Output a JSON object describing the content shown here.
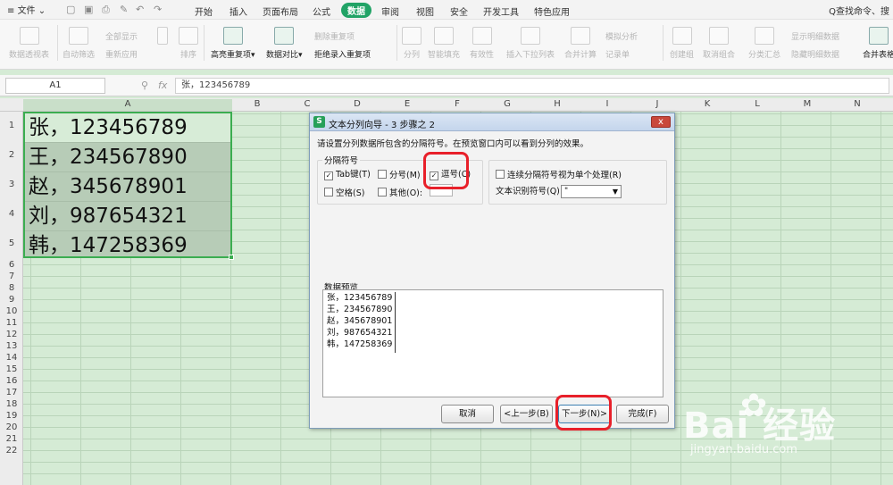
{
  "menubar": {
    "file": "文件",
    "tabs": [
      "开始",
      "插入",
      "页面布局",
      "公式",
      "数据",
      "审阅",
      "视图",
      "安全",
      "开发工具",
      "特色应用"
    ],
    "active_tab": "数据",
    "search": "Q查找命令、搜"
  },
  "ribbon": {
    "pivot": "数据透视表",
    "autofilter": "自动筛选",
    "show_all": "全部显示",
    "reapply": "重新应用",
    "sort": "排序",
    "highlight_dup": "高亮重复项",
    "data_compare": "数据对比",
    "delete_dup": "删除重复项",
    "reject_dup": "拒绝录入重复项",
    "split": "分列",
    "smart_fill": "智能填充",
    "validity": "有效性",
    "insert_dropdown": "插入下拉列表",
    "merge_calc": "合并计算",
    "simulate": "模拟分析",
    "record": "记录单",
    "create_group": "创建组",
    "ungroup": "取消组合",
    "subtotal": "分类汇总",
    "show_detail": "显示明细数据",
    "hide_detail": "隐藏明细数据",
    "merge_table": "合并表格"
  },
  "formulabar": {
    "cell_ref": "A1",
    "fx": "fx",
    "content": "张，123456789"
  },
  "columns": [
    "A",
    "B",
    "C",
    "D",
    "E",
    "F",
    "G",
    "H",
    "I",
    "J",
    "K",
    "L",
    "M",
    "N"
  ],
  "rows": [
    "1",
    "2",
    "3",
    "4",
    "5",
    "6",
    "7",
    "8",
    "9",
    "10",
    "11",
    "12",
    "13",
    "14",
    "15",
    "16",
    "17",
    "18",
    "19",
    "20",
    "21",
    "22"
  ],
  "cells": [
    "张，123456789",
    "王，234567890",
    "赵，345678901",
    "刘，987654321",
    "韩，147258369"
  ],
  "dialog": {
    "title": "文本分列向导 - 3 步骤之 2",
    "logo": "S",
    "close": "x",
    "instruction": "请设置分列数据所包含的分隔符号。在预览窗口内可以看到分列的效果。",
    "delimiter_group": "分隔符号",
    "tab": "Tab键(T)",
    "semicolon": "分号(M)",
    "comma": "逗号(C)",
    "space": "空格(S)",
    "other": "其他(O):",
    "consecutive": "连续分隔符号视为单个处理(R)",
    "qualifier_label": "文本识别符号(Q):",
    "qualifier_value": "\"",
    "preview_label": "数据预览",
    "preview_lines": [
      "张，123456789",
      "王，234567890",
      "赵，345678901",
      "刘，987654321",
      "韩，147258369"
    ],
    "cancel": "取消",
    "back": "<上一步(B)",
    "next": "下一步(N)>",
    "finish": "完成(F)"
  },
  "checks": {
    "tab": true,
    "semicolon": false,
    "comma": true,
    "space": false,
    "other": false,
    "consecutive": false
  },
  "watermark": {
    "brand": "Bai 经验",
    "url": "jingyan.baidu.com"
  }
}
